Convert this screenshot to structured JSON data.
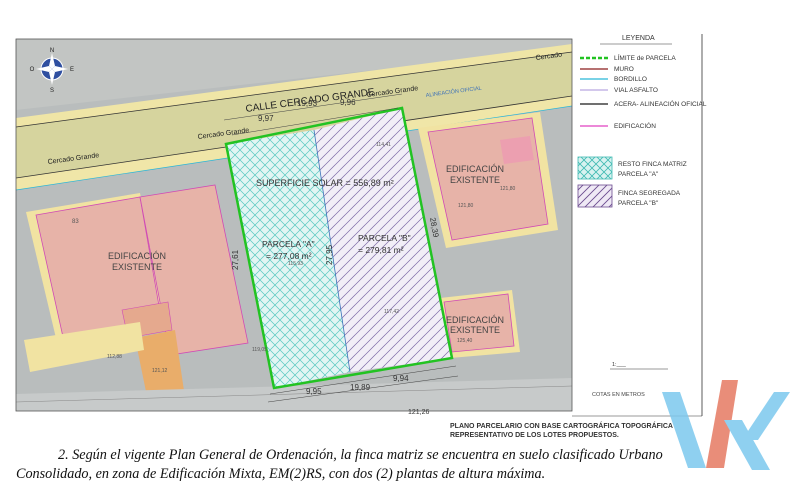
{
  "street": {
    "name_large": "CALLE CERCADO GRANDE",
    "name_small_1": "Cercado Grande",
    "name_small_2": "Cercado Grande",
    "name_small_3": "Cercado Grande",
    "alineacion": "ALINEACIÓN OFICIAL",
    "right_label": "Cercado"
  },
  "plots": {
    "superficie": "SUPERFICIE SOLAR = 556,89 m²",
    "parcela_a": "PARCELA \"A\"",
    "parcela_a_area": "= 277,08 m²",
    "parcela_b": "PARCELA \"B\"",
    "parcela_b_area": "= 279,81 m²"
  },
  "buildings": {
    "left_label_1": "EDIFICACIÓN",
    "left_label_2": "EXISTENTE",
    "right_top_1": "EDIFICACIÓN",
    "right_top_2": "EXISTENTE",
    "right_bottom_1": "EDIFICACIÓN",
    "right_bottom_2": "EXISTENTE"
  },
  "dimensions": [
    "9,97",
    "19,93",
    "9,96",
    "27,61",
    "27,95",
    "28,39",
    "9,95",
    "19,89",
    "9,94",
    "121,26"
  ],
  "elevations": [
    "114,41",
    "115,93",
    "117,42",
    "119,05",
    "112,88",
    "121,12",
    "125,40",
    "121,80",
    "121,80",
    "83"
  ],
  "legend": {
    "title": "LEYENDA",
    "items": [
      {
        "label": "LÍMITE de PARCELA",
        "color": "#22c322"
      },
      {
        "label": "MURO",
        "color": "#8b1c1c"
      },
      {
        "label": "BORDILLO",
        "color": "#29b6d8"
      },
      {
        "label": "VIAL ASFALTO",
        "color": "#b9a6e0"
      },
      {
        "label": "ACERA- ALINEACIÓN OFICIAL",
        "color": "#1a1a1a"
      },
      {
        "label": "EDIFICACIÓN",
        "color": "#e040c0"
      }
    ],
    "resto_1": "RESTO FINCA MATRIZ",
    "resto_2": "PARCELA \"A\"",
    "segregada_1": "FINCA SEGREGADA",
    "segregada_2": "PARCELA \"B\"",
    "scale_label": "COTAS EN METROS",
    "scale_text": "1:___"
  },
  "plan_title_1": "PLANO PARCELARIO CON BASE CARTOGRÁFICA TOPOGRÁFICA",
  "plan_title_2": "REPRESENTATIVO DE LOS LOTES PROPUESTOS.",
  "caption_line_1": "2. Según el vigente Plan General de Ordenación, la finca matriz se encuentra en suelo clasificado Urbano",
  "caption_line_2": "Consolidado, en zona de Edificación Mixta, EM(2)RS, con dos (2) plantas de altura máxima.",
  "colors": {
    "road": "#d4d39a",
    "sidewalk": "#f3e9a8",
    "building": "#e7b3a8",
    "ground": "#b8bcbc",
    "parcel_a_fill": "#e0f4f2",
    "parcel_b_fill": "#eeeaf6"
  }
}
